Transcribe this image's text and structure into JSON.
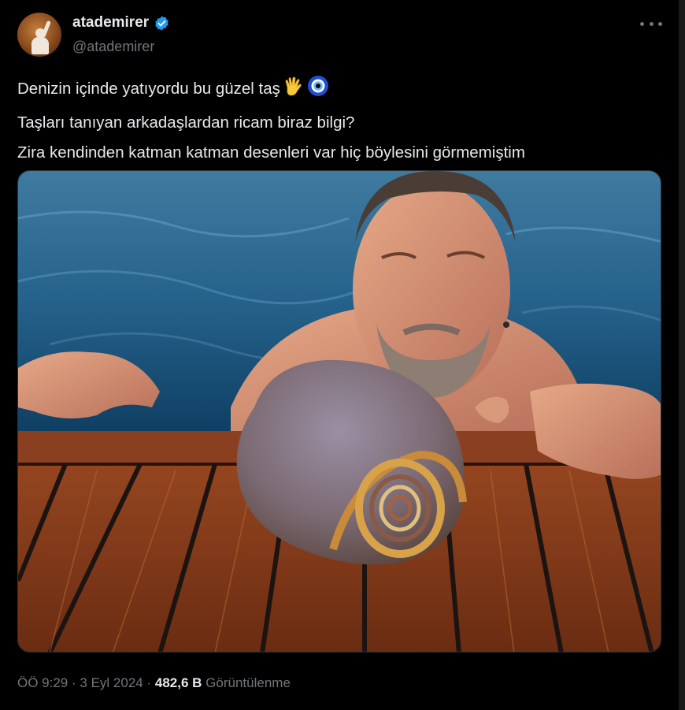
{
  "author": {
    "display_name": "atademirer",
    "handle": "@atademirer",
    "verified": true,
    "verified_color": "#1d9bf0"
  },
  "tweet": {
    "line1": "Denizin içinde yatıyordu bu güzel taş",
    "line2": "Taşları tanıyan arkadaşlardan ricam biraz bilgi?",
    "line3": "Zira kendinden katman katman desenleri var hiç böylesini görmemiştim",
    "emojis": [
      "vulcan-salute-icon",
      "nazar-amulet-icon"
    ]
  },
  "media": {
    "icon": "photo-icon"
  },
  "meta": {
    "time": "ÖÖ 9:29",
    "separator": "·",
    "date": "3 Eyl 2024",
    "views_count": "482,6 B",
    "views_label": "Görüntülenme"
  },
  "colors": {
    "background": "#000000",
    "text": "#e7e9ea",
    "secondary": "#71767b"
  }
}
